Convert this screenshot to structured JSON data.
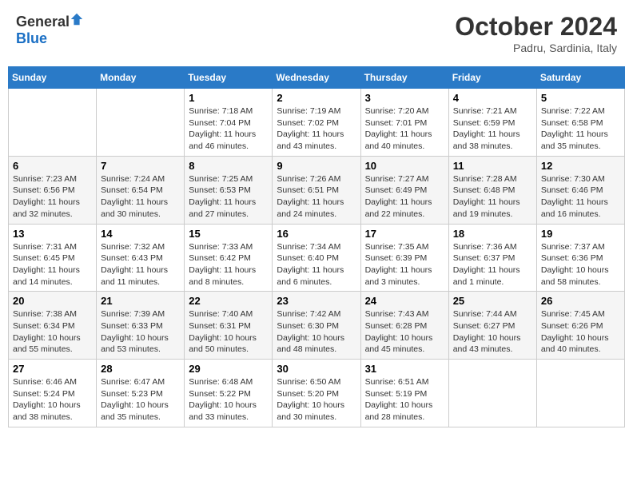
{
  "header": {
    "logo_general": "General",
    "logo_blue": "Blue",
    "month_title": "October 2024",
    "location": "Padru, Sardinia, Italy"
  },
  "weekdays": [
    "Sunday",
    "Monday",
    "Tuesday",
    "Wednesday",
    "Thursday",
    "Friday",
    "Saturday"
  ],
  "weeks": [
    [
      {
        "day": "",
        "info": ""
      },
      {
        "day": "",
        "info": ""
      },
      {
        "day": "1",
        "info": "Sunrise: 7:18 AM\nSunset: 7:04 PM\nDaylight: 11 hours and 46 minutes."
      },
      {
        "day": "2",
        "info": "Sunrise: 7:19 AM\nSunset: 7:02 PM\nDaylight: 11 hours and 43 minutes."
      },
      {
        "day": "3",
        "info": "Sunrise: 7:20 AM\nSunset: 7:01 PM\nDaylight: 11 hours and 40 minutes."
      },
      {
        "day": "4",
        "info": "Sunrise: 7:21 AM\nSunset: 6:59 PM\nDaylight: 11 hours and 38 minutes."
      },
      {
        "day": "5",
        "info": "Sunrise: 7:22 AM\nSunset: 6:58 PM\nDaylight: 11 hours and 35 minutes."
      }
    ],
    [
      {
        "day": "6",
        "info": "Sunrise: 7:23 AM\nSunset: 6:56 PM\nDaylight: 11 hours and 32 minutes."
      },
      {
        "day": "7",
        "info": "Sunrise: 7:24 AM\nSunset: 6:54 PM\nDaylight: 11 hours and 30 minutes."
      },
      {
        "day": "8",
        "info": "Sunrise: 7:25 AM\nSunset: 6:53 PM\nDaylight: 11 hours and 27 minutes."
      },
      {
        "day": "9",
        "info": "Sunrise: 7:26 AM\nSunset: 6:51 PM\nDaylight: 11 hours and 24 minutes."
      },
      {
        "day": "10",
        "info": "Sunrise: 7:27 AM\nSunset: 6:49 PM\nDaylight: 11 hours and 22 minutes."
      },
      {
        "day": "11",
        "info": "Sunrise: 7:28 AM\nSunset: 6:48 PM\nDaylight: 11 hours and 19 minutes."
      },
      {
        "day": "12",
        "info": "Sunrise: 7:30 AM\nSunset: 6:46 PM\nDaylight: 11 hours and 16 minutes."
      }
    ],
    [
      {
        "day": "13",
        "info": "Sunrise: 7:31 AM\nSunset: 6:45 PM\nDaylight: 11 hours and 14 minutes."
      },
      {
        "day": "14",
        "info": "Sunrise: 7:32 AM\nSunset: 6:43 PM\nDaylight: 11 hours and 11 minutes."
      },
      {
        "day": "15",
        "info": "Sunrise: 7:33 AM\nSunset: 6:42 PM\nDaylight: 11 hours and 8 minutes."
      },
      {
        "day": "16",
        "info": "Sunrise: 7:34 AM\nSunset: 6:40 PM\nDaylight: 11 hours and 6 minutes."
      },
      {
        "day": "17",
        "info": "Sunrise: 7:35 AM\nSunset: 6:39 PM\nDaylight: 11 hours and 3 minutes."
      },
      {
        "day": "18",
        "info": "Sunrise: 7:36 AM\nSunset: 6:37 PM\nDaylight: 11 hours and 1 minute."
      },
      {
        "day": "19",
        "info": "Sunrise: 7:37 AM\nSunset: 6:36 PM\nDaylight: 10 hours and 58 minutes."
      }
    ],
    [
      {
        "day": "20",
        "info": "Sunrise: 7:38 AM\nSunset: 6:34 PM\nDaylight: 10 hours and 55 minutes."
      },
      {
        "day": "21",
        "info": "Sunrise: 7:39 AM\nSunset: 6:33 PM\nDaylight: 10 hours and 53 minutes."
      },
      {
        "day": "22",
        "info": "Sunrise: 7:40 AM\nSunset: 6:31 PM\nDaylight: 10 hours and 50 minutes."
      },
      {
        "day": "23",
        "info": "Sunrise: 7:42 AM\nSunset: 6:30 PM\nDaylight: 10 hours and 48 minutes."
      },
      {
        "day": "24",
        "info": "Sunrise: 7:43 AM\nSunset: 6:28 PM\nDaylight: 10 hours and 45 minutes."
      },
      {
        "day": "25",
        "info": "Sunrise: 7:44 AM\nSunset: 6:27 PM\nDaylight: 10 hours and 43 minutes."
      },
      {
        "day": "26",
        "info": "Sunrise: 7:45 AM\nSunset: 6:26 PM\nDaylight: 10 hours and 40 minutes."
      }
    ],
    [
      {
        "day": "27",
        "info": "Sunrise: 6:46 AM\nSunset: 5:24 PM\nDaylight: 10 hours and 38 minutes."
      },
      {
        "day": "28",
        "info": "Sunrise: 6:47 AM\nSunset: 5:23 PM\nDaylight: 10 hours and 35 minutes."
      },
      {
        "day": "29",
        "info": "Sunrise: 6:48 AM\nSunset: 5:22 PM\nDaylight: 10 hours and 33 minutes."
      },
      {
        "day": "30",
        "info": "Sunrise: 6:50 AM\nSunset: 5:20 PM\nDaylight: 10 hours and 30 minutes."
      },
      {
        "day": "31",
        "info": "Sunrise: 6:51 AM\nSunset: 5:19 PM\nDaylight: 10 hours and 28 minutes."
      },
      {
        "day": "",
        "info": ""
      },
      {
        "day": "",
        "info": ""
      }
    ]
  ]
}
